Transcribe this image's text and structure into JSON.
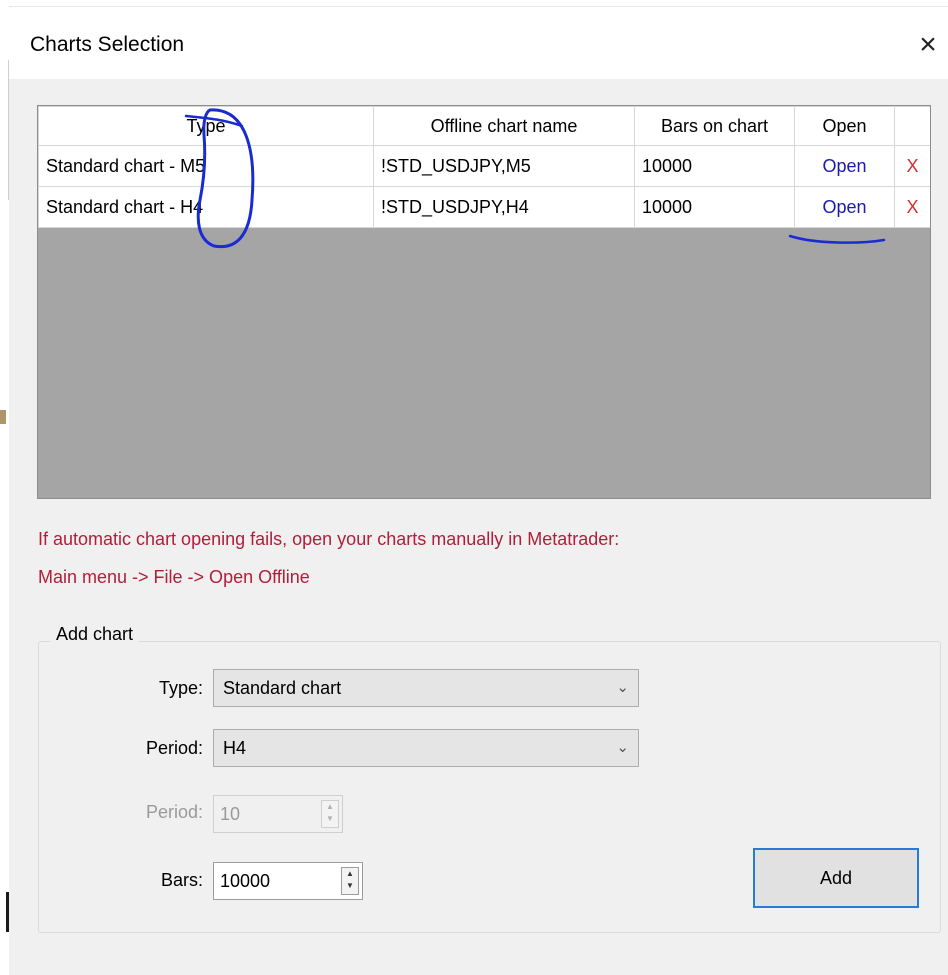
{
  "dialog": {
    "title": "Charts Selection",
    "close_glyph": "×"
  },
  "table": {
    "columns": [
      "Type",
      "Offline chart name",
      "Bars on chart",
      "Open",
      ""
    ],
    "rows": [
      {
        "type": "Standard chart - M5",
        "name": "!STD_USDJPY,M5",
        "bars": "10000",
        "open": "Open",
        "delete": "X"
      },
      {
        "type": "Standard chart - H4",
        "name": "!STD_USDJPY,H4",
        "bars": "10000",
        "open": "Open",
        "delete": "X"
      }
    ]
  },
  "notice": {
    "line1": "If automatic chart opening fails, open your charts manually in Metatrader:",
    "line2": "Main menu -> File -> Open Offline"
  },
  "add_chart": {
    "legend": "Add chart",
    "type_label": "Type:",
    "type_value": "Standard chart",
    "period_label": "Period:",
    "period_value": "H4",
    "custom_period_label": "Period:",
    "custom_period_value": "10",
    "bars_label": "Bars:",
    "bars_value": "10000",
    "add_button": "Add"
  },
  "icons": {
    "close": "close-icon",
    "dropdown": "chevron-down-icon",
    "spinner": "spinner-arrows-icon"
  },
  "colors": {
    "notice_text": "#b01e3a",
    "open_link": "#1a1ab0",
    "delete_x": "#d03030",
    "focus_border": "#2a7ad5",
    "annotation_ink": "#1a2bd0"
  }
}
